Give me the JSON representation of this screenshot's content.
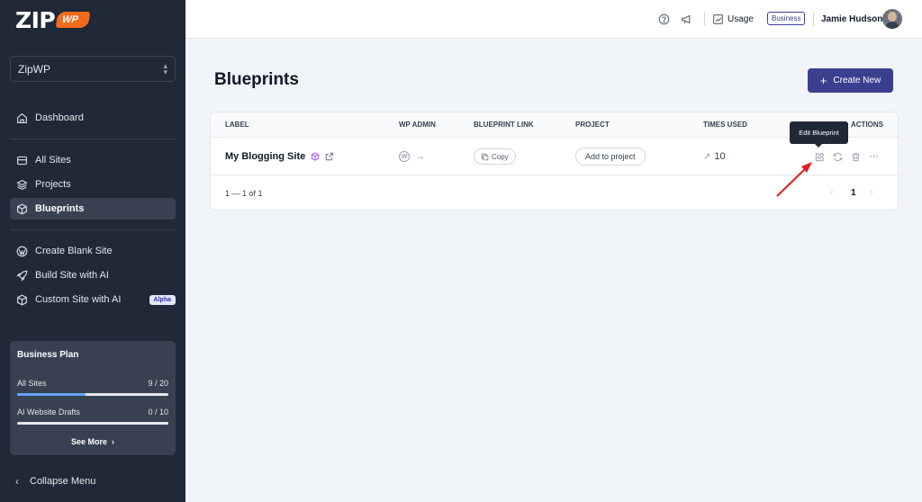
{
  "brand": {
    "logo_main": "ZIP",
    "logo_badge": "WP"
  },
  "sidebar": {
    "workspace": "ZipWP",
    "nav": [
      {
        "label": "Dashboard",
        "icon": "home-icon"
      },
      {
        "label": "All Sites",
        "icon": "layout-icon"
      },
      {
        "label": "Projects",
        "icon": "layers-icon"
      },
      {
        "label": "Blueprints",
        "icon": "cube-icon",
        "active": true
      },
      {
        "label": "Create Blank Site",
        "icon": "wordpress-icon"
      },
      {
        "label": "Build Site with AI",
        "icon": "rocket-icon"
      },
      {
        "label": "Custom Site with AI",
        "icon": "cube-icon",
        "badge": "Alpha"
      }
    ],
    "plan": {
      "title": "Business Plan",
      "rows": [
        {
          "label": "All Sites",
          "value": "9 / 20",
          "fraction": 0.45
        },
        {
          "label": "AI Website Drafts",
          "value": "0 / 10",
          "fraction": 0
        }
      ],
      "see_more": "See More"
    },
    "collapse": "Collapse Menu"
  },
  "topbar": {
    "usage": "Usage",
    "plan_badge": "Business",
    "user_name": "Jamie Hudson"
  },
  "main": {
    "title": "Blueprints",
    "create_button": "Create New",
    "table": {
      "columns": [
        "LABEL",
        "WP ADMIN",
        "BLUEPRINT LINK",
        "PROJECT",
        "TIMES USED",
        "ACTIONS"
      ],
      "rows": [
        {
          "label": "My Blogging Site",
          "copy": "Copy",
          "project": "Add to project",
          "times_used": "10"
        }
      ],
      "pagination": {
        "summary": "1 — 1 of 1",
        "current": "1"
      }
    },
    "tooltip": "Edit Blueprint"
  },
  "colors": {
    "sidebar_bg": "#1f2937",
    "accent": "#3b3f8f",
    "brand_orange": "#f26b1d",
    "annotation_red": "#e11d1d",
    "cube_purple": "#a855f7"
  }
}
